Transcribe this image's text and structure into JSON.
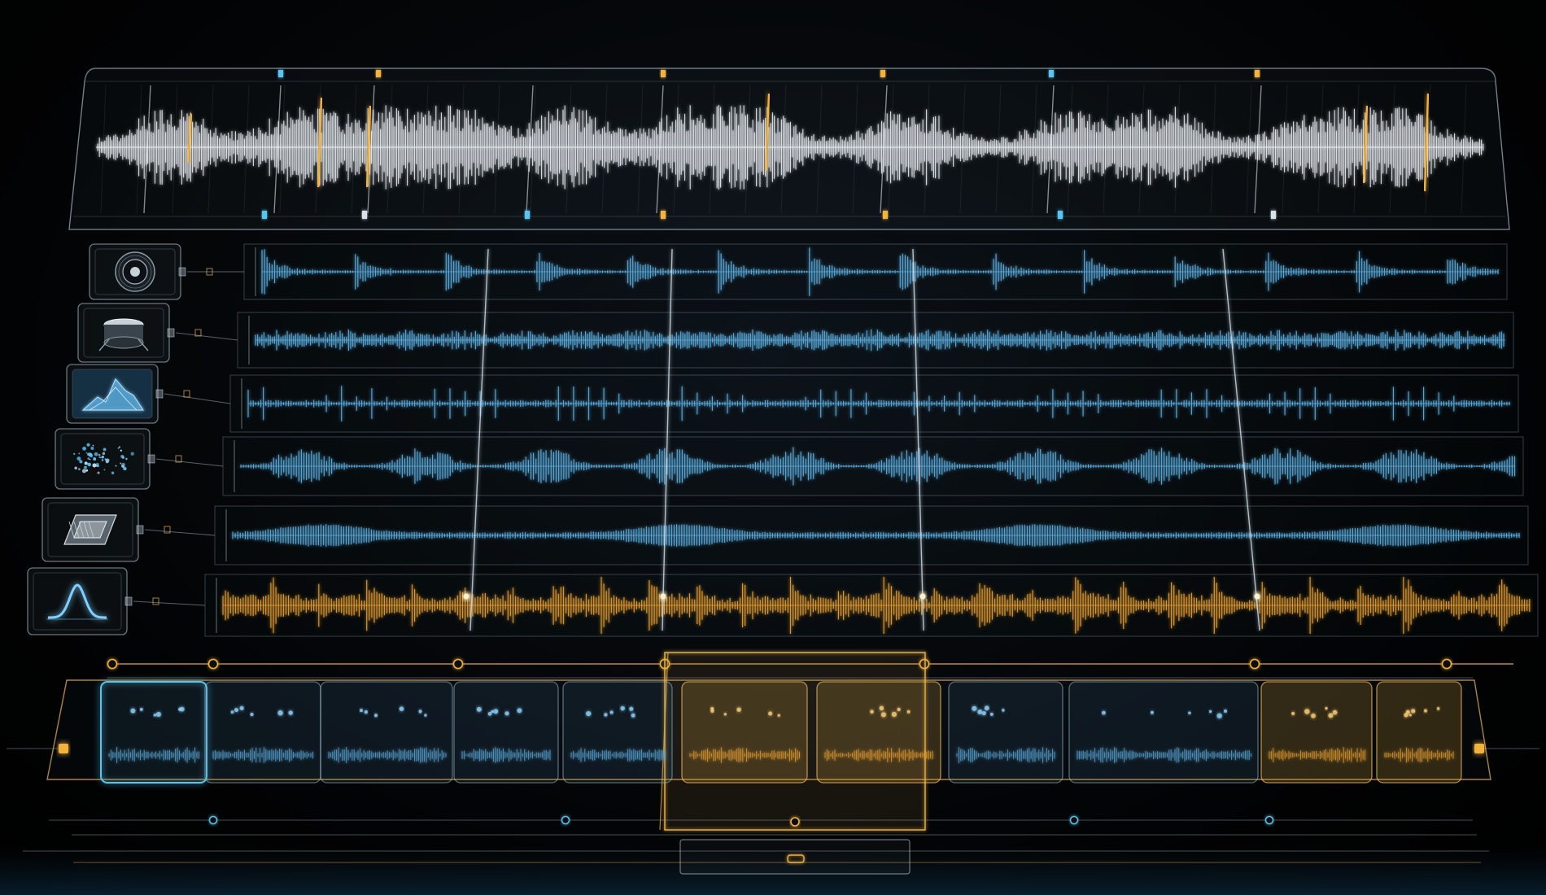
{
  "colors": {
    "white_wave": "#e8edf2",
    "blue_wave": "#5fb3e6",
    "amber_wave": "#f0a533",
    "amber_accent": "#f2b23e",
    "blue_accent": "#58c4f0",
    "frame": "#c5d4df"
  },
  "master_track": {
    "name": "master-waveform",
    "color": "white_wave"
  },
  "tracks": [
    {
      "id": "lane-1",
      "icon": "speaker-icon",
      "color": "blue_wave",
      "style": "bursts"
    },
    {
      "id": "lane-2",
      "icon": "drum-icon",
      "color": "blue_wave",
      "style": "dense"
    },
    {
      "id": "lane-3",
      "icon": "mountain-spectrum-icon",
      "color": "blue_wave",
      "style": "pulses"
    },
    {
      "id": "lane-4",
      "icon": "particle-cloud-icon",
      "color": "blue_wave",
      "style": "clusters"
    },
    {
      "id": "lane-5",
      "icon": "circuit-chip-icon",
      "color": "blue_wave",
      "style": "smooth"
    },
    {
      "id": "lane-6",
      "icon": "bell-curve-icon",
      "color": "amber_wave",
      "style": "bursts"
    }
  ],
  "clips": [
    {
      "id": "clip-1",
      "state": "selected-blue"
    },
    {
      "id": "clip-2",
      "state": "blue"
    },
    {
      "id": "clip-3",
      "state": "blue"
    },
    {
      "id": "clip-4",
      "state": "blue"
    },
    {
      "id": "clip-5",
      "state": "blue"
    },
    {
      "id": "clip-6",
      "state": "amber"
    },
    {
      "id": "clip-7",
      "state": "amber"
    },
    {
      "id": "clip-8",
      "state": "blue"
    },
    {
      "id": "clip-9",
      "state": "blue"
    },
    {
      "id": "clip-10",
      "state": "amber"
    },
    {
      "id": "clip-11",
      "state": "amber"
    }
  ]
}
